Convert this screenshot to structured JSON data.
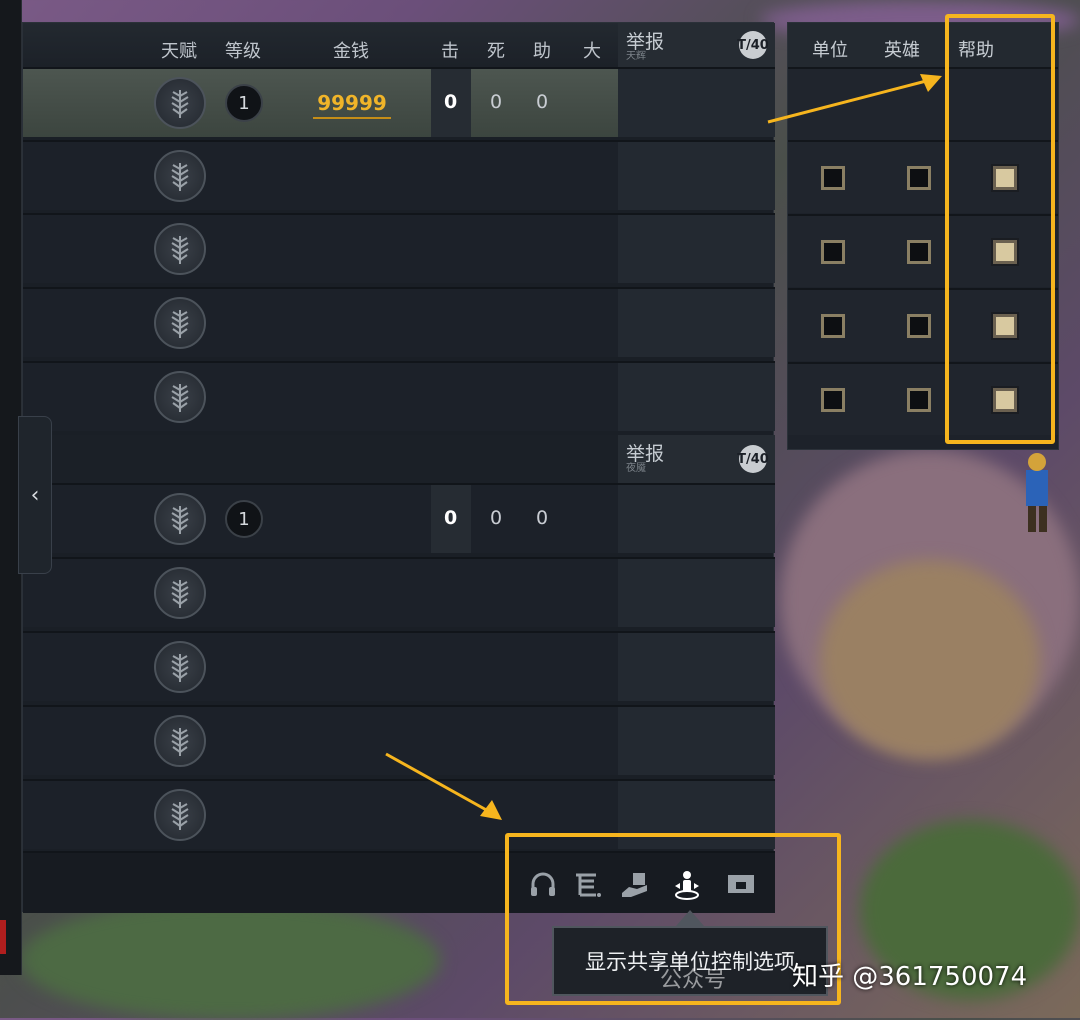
{
  "scoreboard": {
    "headers": {
      "talent": "天赋",
      "level": "等级",
      "gold": "金钱",
      "kills": "击",
      "deaths": "死",
      "assists": "助",
      "ult": "大",
      "report": "举报"
    },
    "team1": {
      "name": "天辉",
      "mute_label": "T/40",
      "player": {
        "level": "1",
        "gold": "99999",
        "kills": "0",
        "deaths": "0",
        "assists": "0"
      }
    },
    "team2": {
      "report": "举报",
      "name": "夜魇",
      "mute_label": "T/40",
      "player": {
        "level": "1",
        "kills": "0",
        "deaths": "0",
        "assists": "0"
      }
    },
    "collapse_glyph": "‹"
  },
  "share_panel": {
    "headers": {
      "unit": "单位",
      "hero": "英雄",
      "help": "帮助"
    },
    "rows": [
      {
        "unit": false,
        "hero": false,
        "help": true
      },
      {
        "unit": false,
        "hero": false,
        "help": true
      },
      {
        "unit": false,
        "hero": false,
        "help": true
      },
      {
        "unit": false,
        "hero": false,
        "help": true
      }
    ]
  },
  "footer": {
    "icons": [
      "headset-icon",
      "chat-log-icon",
      "hand-share-icon",
      "shared-unit-control-icon",
      "ticket-icon"
    ],
    "tooltip": "显示共享单位控制选项"
  },
  "watermark": {
    "main": "知乎 @361750074",
    "secondary": "公众号"
  },
  "colors": {
    "highlight": "#f6b51e",
    "gold": "#f0b429",
    "panel": "#1a1f26"
  }
}
